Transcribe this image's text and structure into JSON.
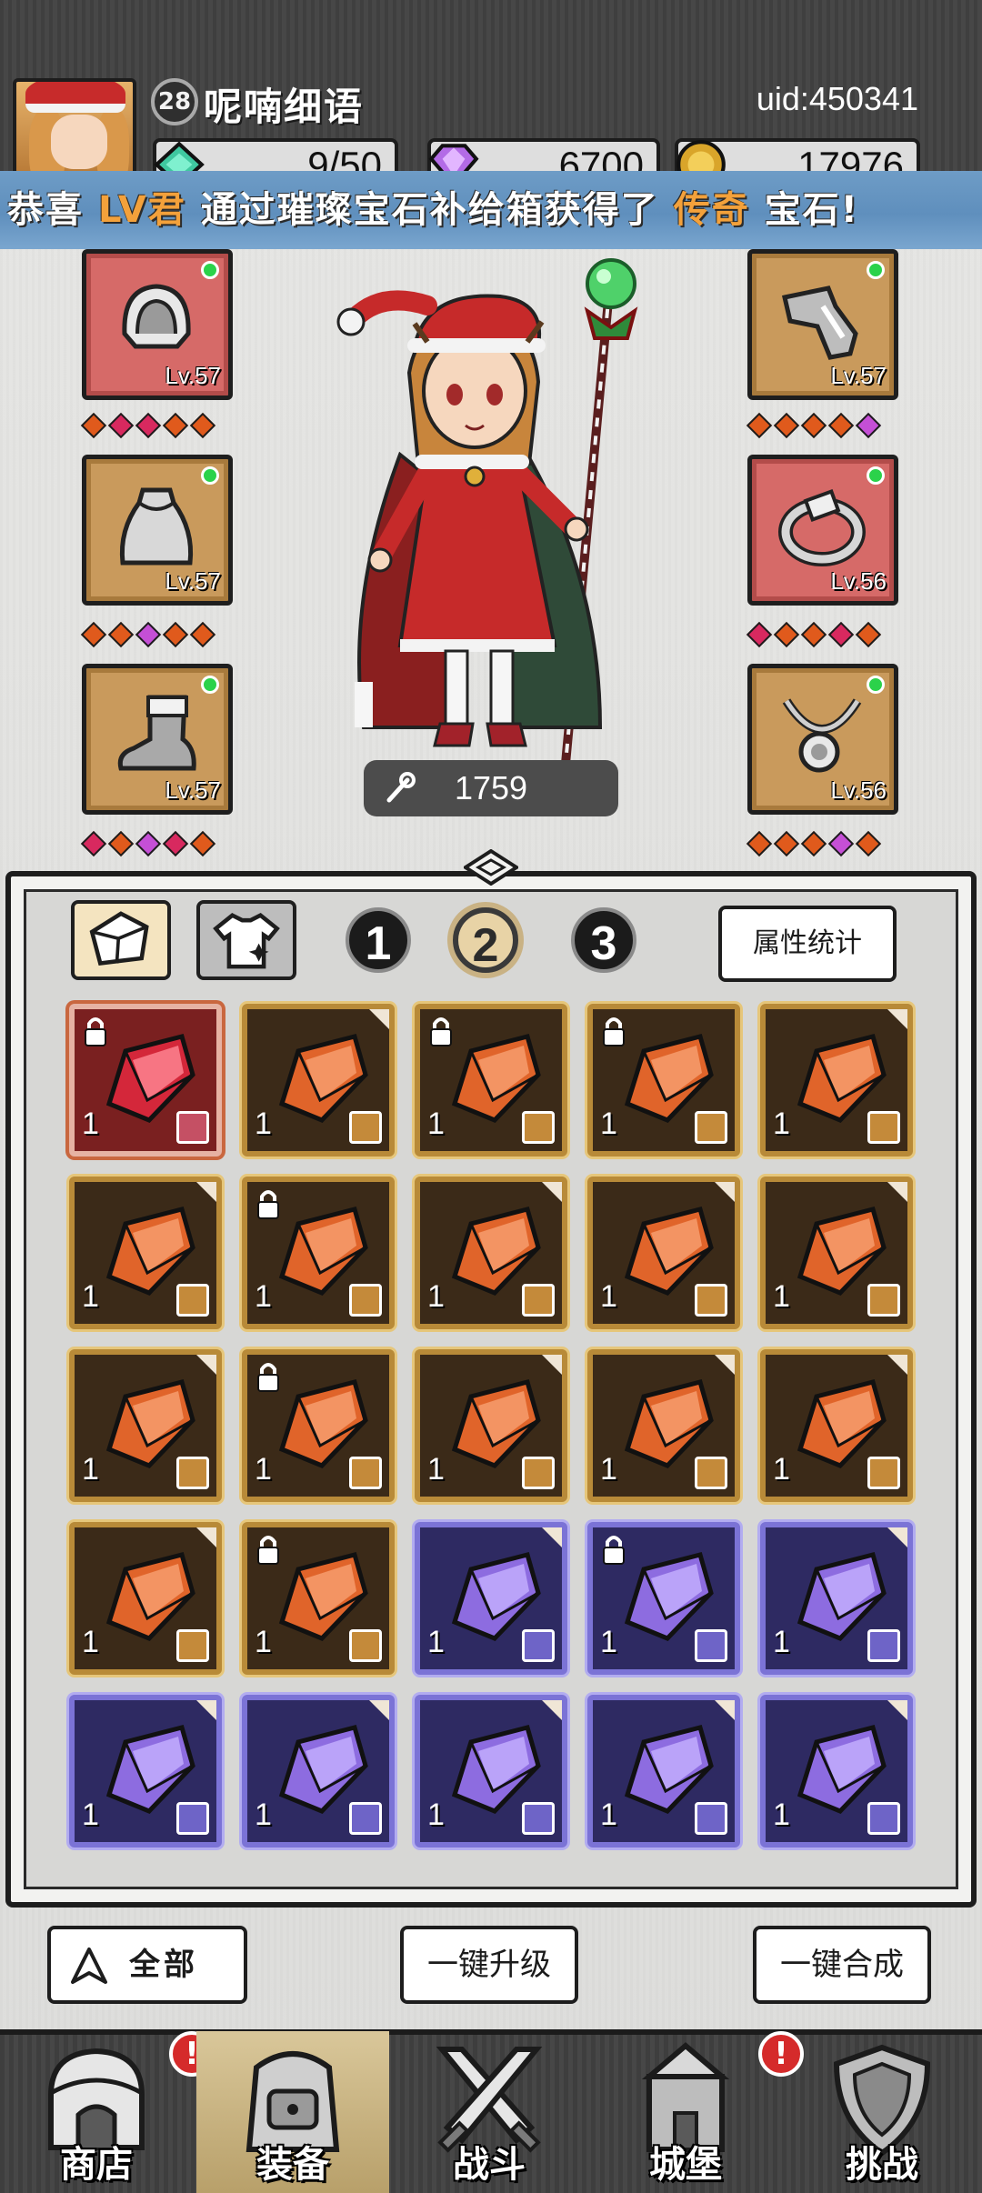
{
  "player": {
    "level": "28",
    "name": "呢喃细语",
    "uid": "uid:450341"
  },
  "resources": [
    {
      "icon": "green-gem-icon",
      "value": "9/50"
    },
    {
      "icon": "purple-gem-icon",
      "value": "6700"
    },
    {
      "icon": "gold-coin-icon",
      "value": "17976"
    }
  ],
  "banner": {
    "part1": "恭喜",
    "player": "LV君",
    "part2": "通过璀璨宝石补给箱获得了",
    "rarity": "传奇",
    "part3": "宝石!"
  },
  "equipment": {
    "left": [
      {
        "item": "helmet",
        "level": "Lv.57",
        "bg": "red",
        "gems": [
          "o",
          "r",
          "r",
          "o",
          "o"
        ]
      },
      {
        "item": "cape",
        "level": "Lv.57",
        "bg": "gold",
        "gems": [
          "o",
          "o",
          "p",
          "o",
          "o"
        ]
      },
      {
        "item": "boots",
        "level": "Lv.57",
        "bg": "gold",
        "gems": [
          "r",
          "o",
          "p",
          "r",
          "o"
        ]
      }
    ],
    "right": [
      {
        "item": "gauntlet",
        "level": "Lv.57",
        "bg": "gold",
        "gems": [
          "o",
          "o",
          "o",
          "o",
          "p"
        ]
      },
      {
        "item": "ring",
        "level": "Lv.56",
        "bg": "red",
        "gems": [
          "r",
          "o",
          "o",
          "r",
          "o"
        ]
      },
      {
        "item": "necklace",
        "level": "Lv.56",
        "bg": "gold",
        "gems": [
          "o",
          "o",
          "o",
          "p",
          "o"
        ]
      }
    ]
  },
  "hero": {
    "power": "1759"
  },
  "tabs": {
    "numbers": [
      "1",
      "2",
      "3"
    ],
    "active_number": "2",
    "stats_label": "属性统计"
  },
  "gems": [
    {
      "rarity": "epic-red",
      "qty": "1",
      "locked": true
    },
    {
      "rarity": "orange",
      "qty": "1",
      "locked": false
    },
    {
      "rarity": "orange",
      "qty": "1",
      "locked": true
    },
    {
      "rarity": "orange",
      "qty": "1",
      "locked": true
    },
    {
      "rarity": "orange",
      "qty": "1",
      "locked": false
    },
    {
      "rarity": "orange",
      "qty": "1",
      "locked": false
    },
    {
      "rarity": "orange",
      "qty": "1",
      "locked": true
    },
    {
      "rarity": "orange",
      "qty": "1",
      "locked": false
    },
    {
      "rarity": "orange",
      "qty": "1",
      "locked": false
    },
    {
      "rarity": "orange",
      "qty": "1",
      "locked": false
    },
    {
      "rarity": "orange",
      "qty": "1",
      "locked": false
    },
    {
      "rarity": "orange",
      "qty": "1",
      "locked": true
    },
    {
      "rarity": "orange",
      "qty": "1",
      "locked": false
    },
    {
      "rarity": "orange",
      "qty": "1",
      "locked": false
    },
    {
      "rarity": "orange",
      "qty": "1",
      "locked": false
    },
    {
      "rarity": "orange",
      "qty": "1",
      "locked": false
    },
    {
      "rarity": "orange",
      "qty": "1",
      "locked": true
    },
    {
      "rarity": "purple",
      "qty": "1",
      "locked": false
    },
    {
      "rarity": "purple",
      "qty": "1",
      "locked": true
    },
    {
      "rarity": "purple",
      "qty": "1",
      "locked": false
    },
    {
      "rarity": "purple",
      "qty": "1",
      "locked": false
    },
    {
      "rarity": "purple",
      "qty": "1",
      "locked": false
    },
    {
      "rarity": "purple",
      "qty": "1",
      "locked": false
    },
    {
      "rarity": "purple",
      "qty": "1",
      "locked": false
    },
    {
      "rarity": "purple",
      "qty": "1",
      "locked": false
    }
  ],
  "footer": {
    "all_label": "全部",
    "upgrade_label": "一键升级",
    "merge_label": "一键合成"
  },
  "nav": [
    {
      "label": "商店",
      "icon": "shop-icon",
      "alert": "!",
      "active": false
    },
    {
      "label": "装备",
      "icon": "backpack-icon",
      "alert": "",
      "active": true
    },
    {
      "label": "战斗",
      "icon": "crossed-swords-icon",
      "alert": "",
      "active": false
    },
    {
      "label": "城堡",
      "icon": "castle-icon",
      "alert": "!",
      "active": false
    },
    {
      "label": "挑战",
      "icon": "shield-icon",
      "alert": "",
      "active": false
    }
  ],
  "colors": {
    "banner_bg": "#6e9cc6",
    "highlight": "#f3a13b",
    "orange_gem": "#e0642a",
    "purple_gem": "#8d6ce0",
    "red_gem": "#d4273a"
  }
}
